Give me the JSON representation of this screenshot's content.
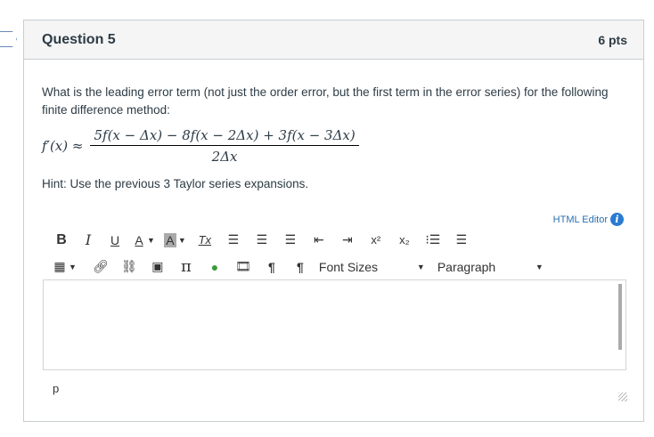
{
  "question": {
    "title": "Question 5",
    "points": "6 pts",
    "text": "What is the leading error term (not just the order error, but the first term in the error series) for the following finite difference method:",
    "formula": {
      "lhs": "f′(x) ≈",
      "numerator": "5f(x − Δx) − 8f(x − 2Δx) + 3f(x − 3Δx)",
      "denominator": "2Δx"
    },
    "hint": "Hint: Use the previous 3 Taylor series expansions."
  },
  "editor": {
    "html_editor_link": "HTML Editor",
    "info_icon": "i",
    "toolbar": {
      "bold": "B",
      "italic": "I",
      "underline": "U",
      "font_color": "A",
      "bg_color": "A",
      "clear_format": "Tx",
      "superscript": "x²",
      "subscript": "x₂",
      "pi": "π",
      "font_sizes": "Font Sizes",
      "paragraph": "Paragraph"
    },
    "content": "",
    "status_path": "p"
  }
}
